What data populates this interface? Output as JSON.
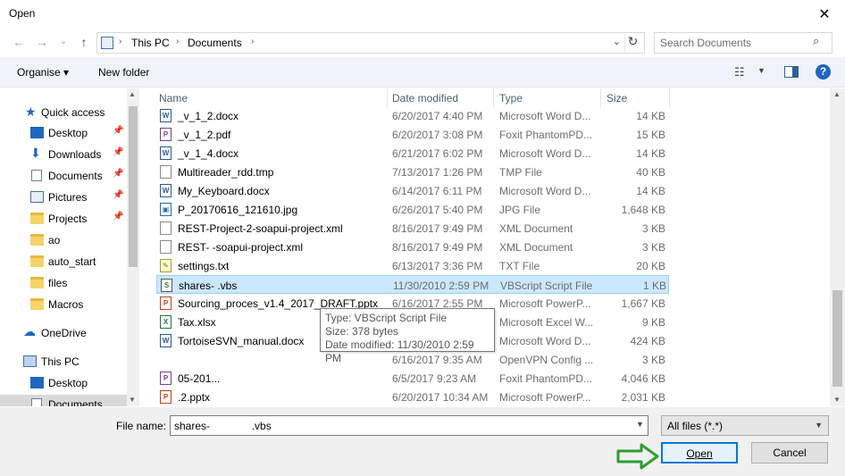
{
  "window": {
    "title": "Open",
    "close": "✕"
  },
  "nav_buttons": {
    "back": "←",
    "forward": "→",
    "recent": "⌄",
    "up": "↑"
  },
  "address": {
    "crumbs": [
      "This PC",
      "Documents"
    ],
    "sep": "›",
    "drop": "⌄",
    "refresh": "↻"
  },
  "search": {
    "placeholder": "Search Documents",
    "icon": "⌕"
  },
  "toolbar": {
    "organise": "Organise ▾",
    "new_folder": "New folder",
    "help": "?"
  },
  "sidebar": {
    "items": [
      {
        "label": "Quick access",
        "icon": "star-icon"
      },
      {
        "label": "Desktop",
        "icon": "desktop-icon",
        "pinned": true
      },
      {
        "label": "Downloads",
        "icon": "download-icon",
        "pinned": true
      },
      {
        "label": "Documents",
        "icon": "documents-icon",
        "pinned": true
      },
      {
        "label": "Pictures",
        "icon": "pictures-icon",
        "pinned": true
      },
      {
        "label": "Projects",
        "icon": "folder-icon",
        "pinned": true
      },
      {
        "label": "ao",
        "icon": "folder-icon"
      },
      {
        "label": "auto_start",
        "icon": "folder-icon"
      },
      {
        "label": "files",
        "icon": "folder-icon"
      },
      {
        "label": "Macros",
        "icon": "folder-icon"
      },
      {
        "label": "OneDrive",
        "icon": "cloud-icon"
      },
      {
        "label": "This PC",
        "icon": "pc-icon"
      },
      {
        "label": "Desktop",
        "icon": "desktop-icon"
      },
      {
        "label": "Documents",
        "icon": "documents-icon"
      }
    ],
    "pin": "📌"
  },
  "columns": {
    "name": "Name",
    "date": "Date modified",
    "type": "Type",
    "size": "Size",
    "sort": "^"
  },
  "files": [
    {
      "name": "_v_1_2.docx",
      "date": "6/20/2017 4:40 PM",
      "type": "Microsoft Word D...",
      "size": "14 KB",
      "kind": "word",
      "glyph": "W"
    },
    {
      "name": "_v_1_2.pdf",
      "date": "6/20/2017 3:08 PM",
      "type": "Foxit PhantomPD...",
      "size": "15 KB",
      "kind": "pdf",
      "glyph": "P"
    },
    {
      "name": "_v_1_4.docx",
      "date": "6/21/2017 6:02 PM",
      "type": "Microsoft Word D...",
      "size": "14 KB",
      "kind": "word",
      "glyph": "W"
    },
    {
      "name": "Multireader_rdd.tmp",
      "date": "7/13/2017 1:26 PM",
      "type": "TMP File",
      "size": "40 KB",
      "kind": "file",
      "glyph": ""
    },
    {
      "name": "My_Keyboard.docx",
      "date": "6/14/2017 6:11 PM",
      "type": "Microsoft Word D...",
      "size": "14 KB",
      "kind": "word",
      "glyph": "W"
    },
    {
      "name": "P_20170616_121610.jpg",
      "date": "6/26/2017 5:40 PM",
      "type": "JPG File",
      "size": "1,648 KB",
      "kind": "jpg",
      "glyph": "▣"
    },
    {
      "name": "REST-Project-2-soapui-project.xml",
      "date": "8/16/2017 9:49 PM",
      "type": "XML Document",
      "size": "3 KB",
      "kind": "file",
      "glyph": ""
    },
    {
      "name": "REST-                    -soapui-project.xml",
      "date": "8/16/2017 9:49 PM",
      "type": "XML Document",
      "size": "3 KB",
      "kind": "file",
      "glyph": ""
    },
    {
      "name": "settings.txt",
      "date": "6/13/2017 3:36 PM",
      "type": "TXT File",
      "size": "20 KB",
      "kind": "txt",
      "glyph": "✎"
    },
    {
      "name": "shares-           .vbs",
      "date": "11/30/2010 2:59 PM",
      "type": "VBScript Script File",
      "size": "1 KB",
      "kind": "vbs",
      "glyph": "S",
      "selected": true
    },
    {
      "name": "Sourcing_proces_v1.4_2017_DRAFT.pptx",
      "date": "6/16/2017 2:55 PM",
      "type": "Microsoft PowerP...",
      "size": "1,667 KB",
      "kind": "ppt",
      "glyph": "P"
    },
    {
      "name": "Tax.xlsx",
      "date": "",
      "type": "Microsoft Excel W...",
      "size": "9 KB",
      "kind": "xls",
      "glyph": "X"
    },
    {
      "name": "TortoiseSVN_manual.docx",
      "date": "",
      "type": "Microsoft Word D...",
      "size": "424 KB",
      "kind": "word",
      "glyph": "W"
    },
    {
      "name": "",
      "date": "6/16/2017 9:35 AM",
      "type": "OpenVPN Config ...",
      "size": "3 KB",
      "kind": "none",
      "glyph": ""
    },
    {
      "name": "                                      05-201...",
      "date": "6/5/2017 9:23 AM",
      "type": "Foxit PhantomPD...",
      "size": "4,046 KB",
      "kind": "pdf",
      "glyph": "P"
    },
    {
      "name": "       .2.pptx",
      "date": "6/20/2017 10:34 AM",
      "type": "Microsoft PowerP...",
      "size": "2,031 KB",
      "kind": "ppt",
      "glyph": "P"
    }
  ],
  "tooltip": {
    "type": "Type: VBScript Script File",
    "size": "Size: 378 bytes",
    "date": "Date modified: 11/30/2010 2:59 PM"
  },
  "footer": {
    "file_name_label": "File name:",
    "file_name_value": "shares-              .vbs",
    "filter": "All files (*.*)",
    "open": "Open",
    "cancel": "Cancel"
  },
  "colors": {
    "accent": "#0078d7",
    "selection": "#cce8ff",
    "arrow": "#2e9e2e"
  }
}
